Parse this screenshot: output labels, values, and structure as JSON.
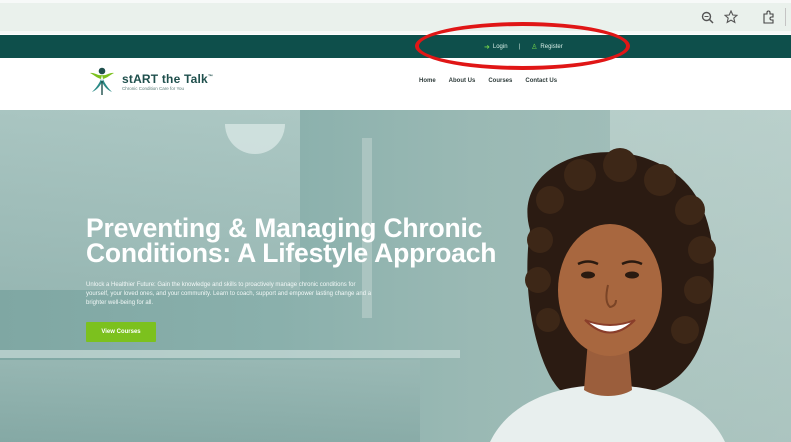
{
  "browser": {
    "icons": [
      "zoom-icon",
      "star-icon",
      "extensions-icon"
    ]
  },
  "topbar": {
    "login_label": "Login",
    "divider": "|",
    "register_label": "Register",
    "bg_color": "#0e4f4b",
    "icon_color": "#6fcf4a"
  },
  "logo": {
    "name": "stART the Talk",
    "trademark": "™",
    "tagline": "Chronic Condition Care for You"
  },
  "nav": {
    "items": [
      "Home",
      "About Us",
      "Courses",
      "Contact Us"
    ]
  },
  "hero": {
    "title": "Preventing & Managing Chronic Conditions: A Lifestyle Approach",
    "description": "Unlock a Healthier Future: Gain the knowledge and skills to proactively manage chronic conditions for yourself, your loved ones, and your community. Learn to coach, support and empower lasting change and a brighter well-being for all.",
    "cta_label": "View Courses",
    "cta_color": "#7cc11e"
  },
  "annotation": {
    "color": "#e01616"
  }
}
